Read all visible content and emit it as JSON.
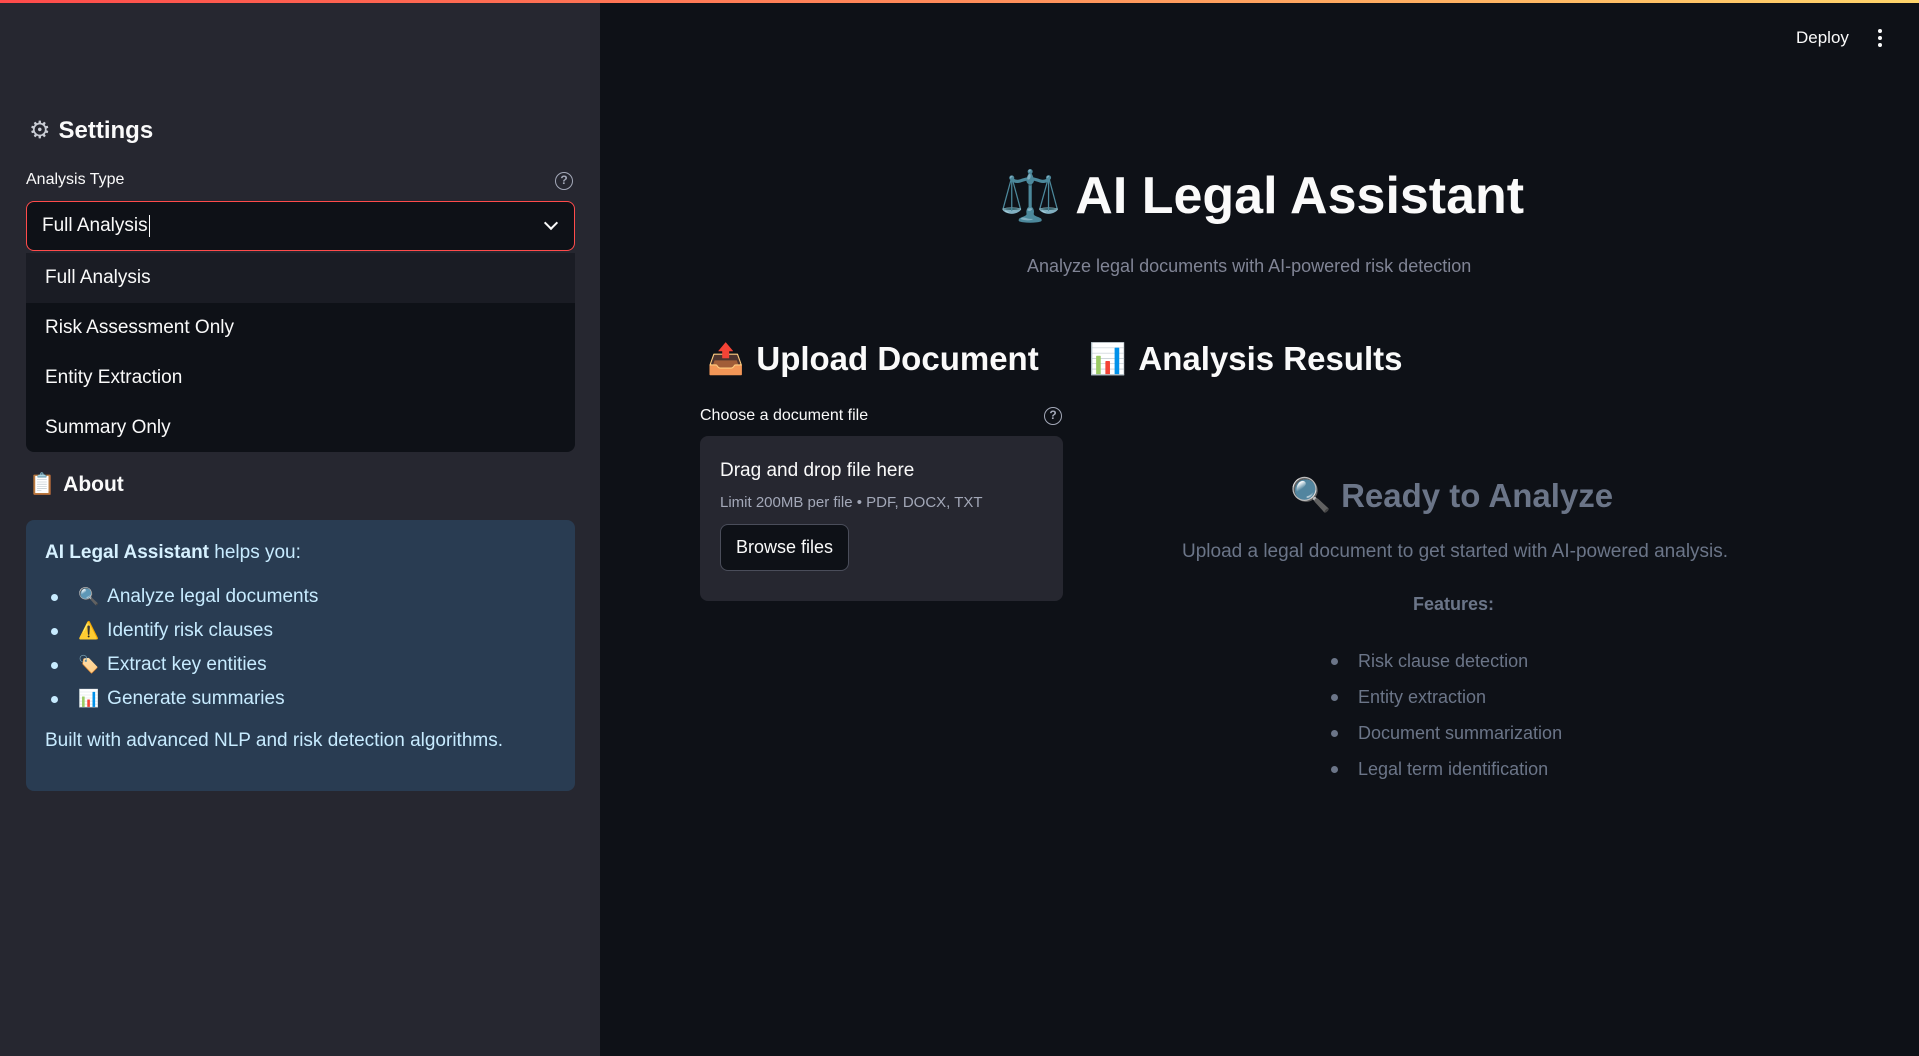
{
  "header": {
    "deploy_label": "Deploy",
    "menu_icon": "kebab-menu-icon",
    "accent_gradient": [
      "#ff4b4b",
      "#ffd56b"
    ]
  },
  "sidebar": {
    "settings_icon": "gear-icon",
    "settings_title": "Settings",
    "analysis_type": {
      "label": "Analysis Type",
      "value": "Full Analysis",
      "options": [
        "Full Analysis",
        "Risk Assessment Only",
        "Entity Extraction",
        "Summary Only"
      ]
    },
    "about": {
      "icon": "clipboard-icon",
      "title": "About",
      "intro_bold": "AI Legal Assistant",
      "intro_rest": " helps you:",
      "items": [
        {
          "icon": "🔍",
          "text": "Analyze legal documents"
        },
        {
          "icon": "⚠️",
          "text": "Identify risk clauses"
        },
        {
          "icon": "🏷️",
          "text": "Extract key entities"
        },
        {
          "icon": "📊",
          "text": "Generate summaries"
        }
      ],
      "footer": "Built with advanced NLP and risk detection algorithms."
    }
  },
  "main": {
    "title_icon": "⚖️",
    "title": "AI Legal Assistant",
    "subtitle": "Analyze legal documents with AI-powered risk detection",
    "upload": {
      "icon": "📤",
      "heading": "Upload Document",
      "label": "Choose a document file",
      "dropzone_title": "Drag and drop file here",
      "dropzone_limit": "Limit 200MB per file • PDF, DOCX, TXT",
      "browse_label": "Browse files"
    },
    "results": {
      "icon": "📊",
      "heading": "Analysis Results",
      "ready_icon": "🔍",
      "ready_title": "Ready to Analyze",
      "ready_text": "Upload a legal document to get started with AI-powered analysis.",
      "features_label": "Features:",
      "features": [
        "Risk clause detection",
        "Entity extraction",
        "Document summarization",
        "Legal term identification"
      ]
    }
  }
}
